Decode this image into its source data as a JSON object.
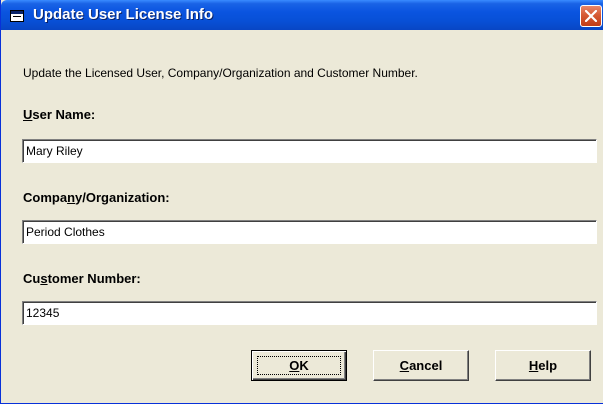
{
  "window": {
    "title": "Update User License Info",
    "icons": {
      "app": "window-icon",
      "close": "close-icon"
    }
  },
  "instructions": "Update the Licensed User, Company/Organization and Customer Number.",
  "fields": {
    "user_name": {
      "label_pre": "",
      "label_key": "U",
      "label_post": "ser Name:",
      "value": "Mary Riley"
    },
    "company": {
      "label_pre": "Compa",
      "label_key": "n",
      "label_post": "y/Organization:",
      "value": "Period Clothes"
    },
    "customer_number": {
      "label_pre": "Cu",
      "label_key": "s",
      "label_post": "tomer Number:",
      "value": "12345"
    }
  },
  "buttons": {
    "ok": {
      "pre": "",
      "key": "O",
      "post": "K"
    },
    "cancel": {
      "pre": "",
      "key": "C",
      "post": "ancel"
    },
    "help": {
      "pre": "",
      "key": "H",
      "post": "elp"
    }
  },
  "colors": {
    "titlebar": "#0a54e0",
    "close": "#d65a34",
    "face": "#ece9d8"
  }
}
